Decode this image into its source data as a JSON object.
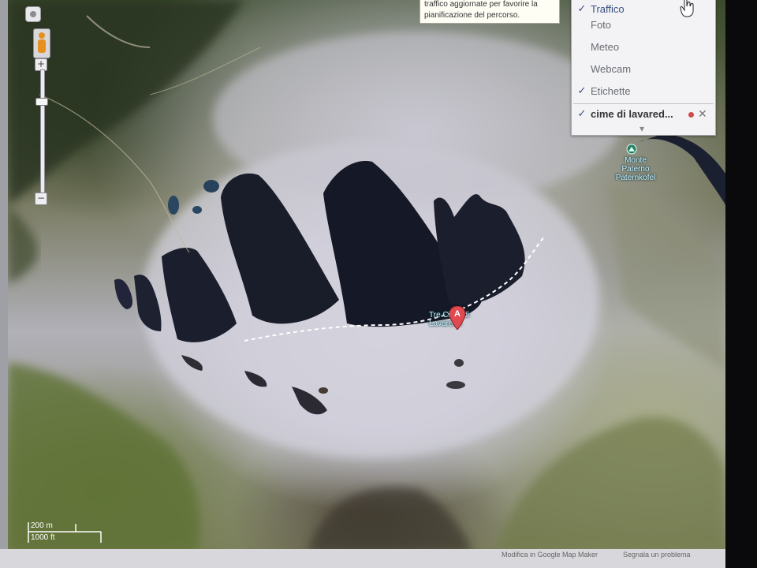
{
  "map": {
    "type": "satellite",
    "place_labels": [
      {
        "text": "Tre Cime di Lavaredo",
        "kind": "landmark"
      },
      {
        "text": "Monte Paterno Paternkofel",
        "kind": "peak"
      }
    ],
    "marker": {
      "label": "A"
    },
    "scale": {
      "metric": "200 m",
      "imperial": "1000 ft"
    }
  },
  "tooltip": {
    "line1": "traffico aggiornate per favorire la",
    "line2": "pianificazione del percorso."
  },
  "layers_menu": {
    "items": [
      {
        "label": "Traffico",
        "checked": true
      },
      {
        "label": "Foto",
        "checked": false
      },
      {
        "label": "Meteo",
        "checked": false
      },
      {
        "label": "Webcam",
        "checked": false
      },
      {
        "label": "Etichette",
        "checked": true
      },
      {
        "label": "cime di lavared...",
        "checked": true,
        "custom": true
      }
    ]
  },
  "controls": {
    "zoom_in": "+",
    "zoom_out": "−"
  },
  "footer": {
    "map_maker": "Modifica in Google Map Maker",
    "report": "Segnala un problema"
  },
  "colors": {
    "snow": "#d3d2dc",
    "shadow": "#1a1d2b",
    "forest": "#4a5a35",
    "marker": "#e24a52",
    "route": "#ffffff"
  }
}
